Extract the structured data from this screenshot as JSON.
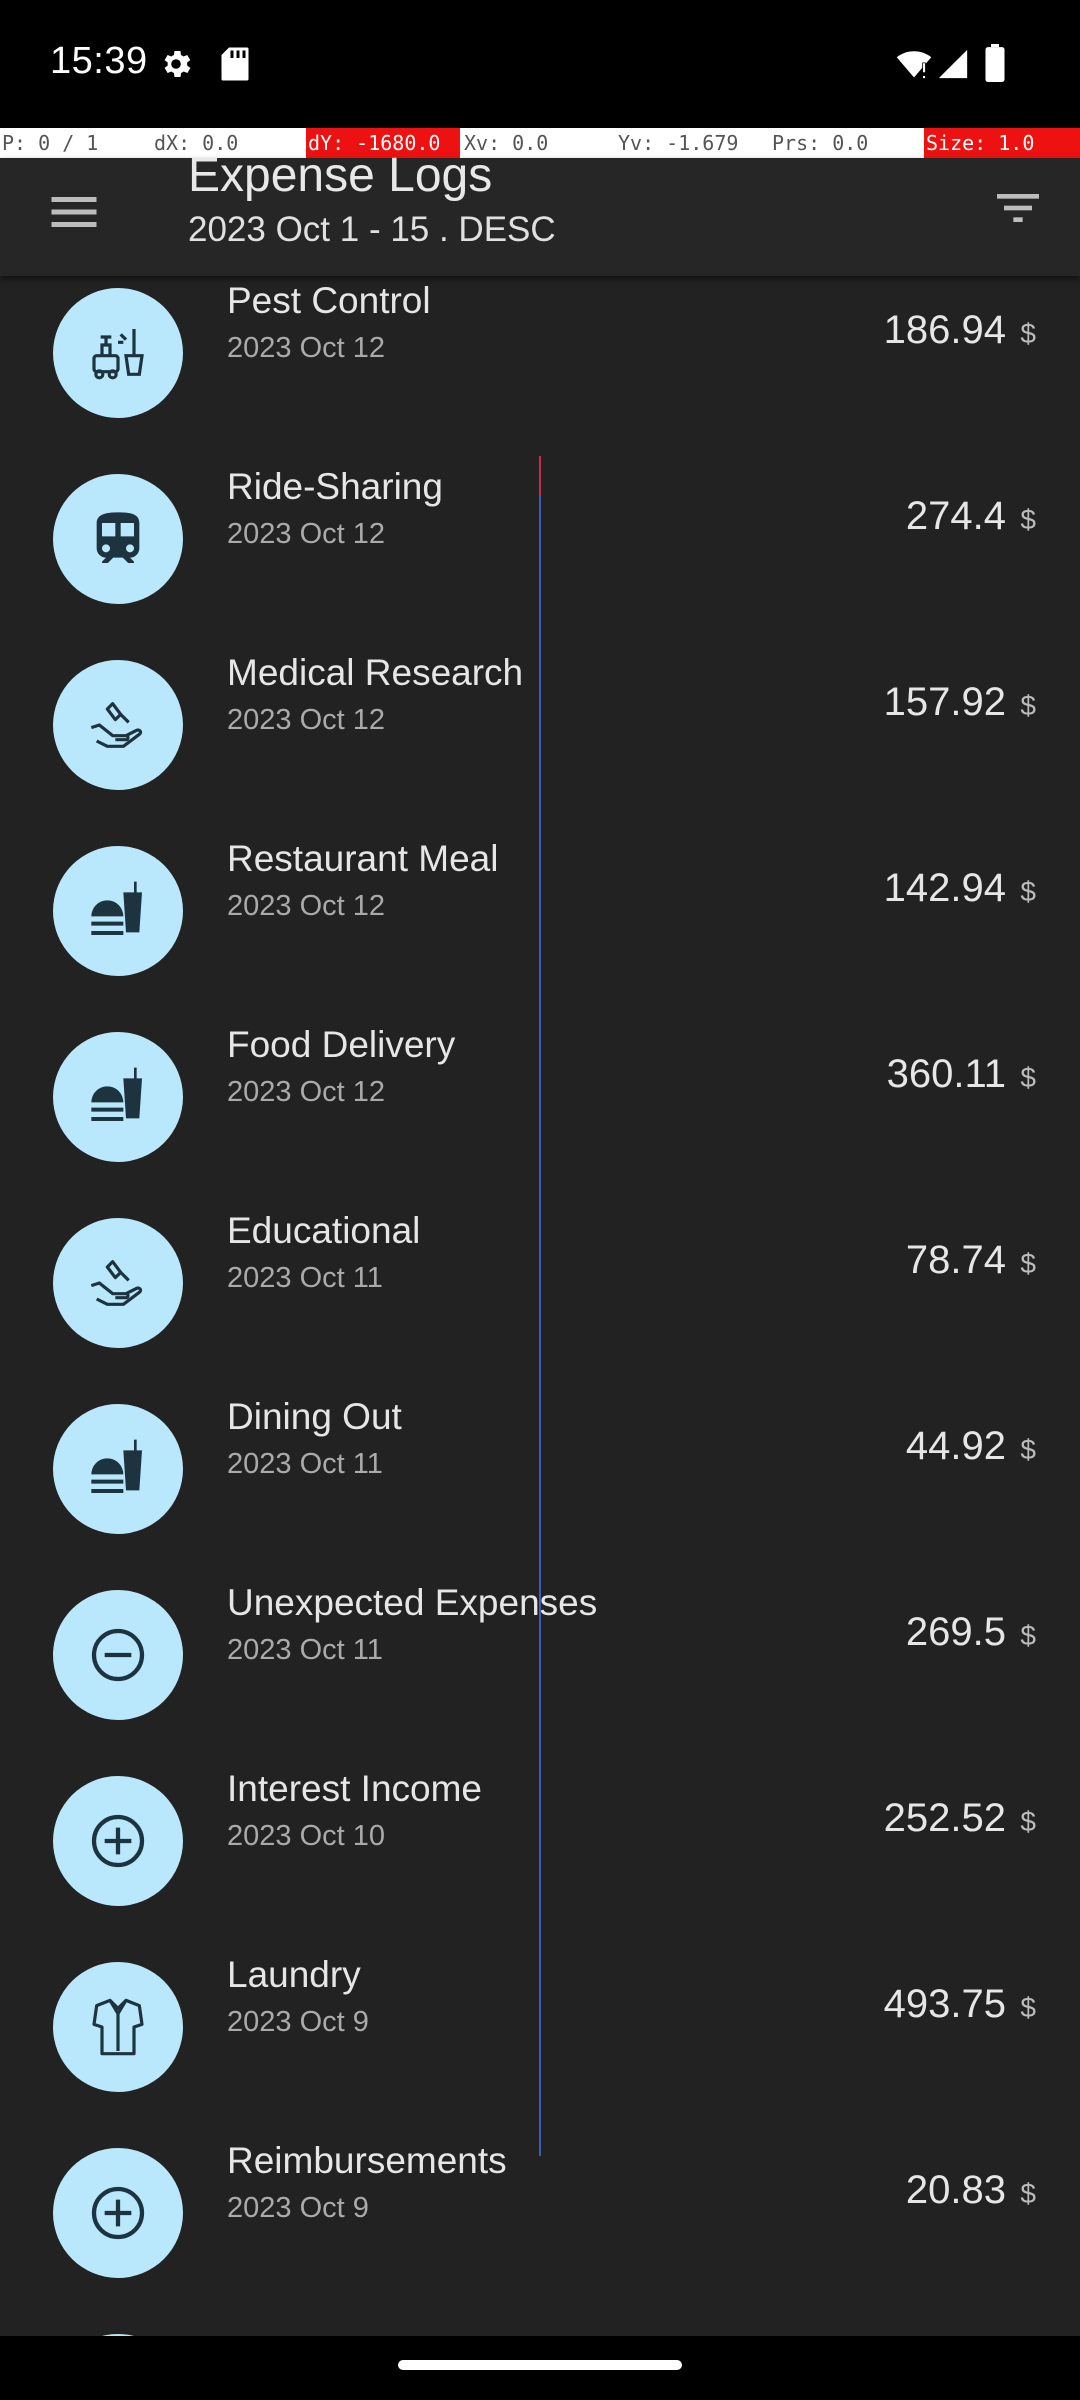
{
  "status_bar": {
    "time": "15:39",
    "icons": [
      "settings-gear-icon",
      "sd-card-icon",
      "wifi-icon",
      "cell-signal-icon",
      "battery-icon"
    ]
  },
  "debug_overlay": {
    "pointer": "P: 0 / 1",
    "dx": "dX: 0.0",
    "dy": "dY: -1680.0",
    "xv": "Xv: 0.0",
    "yv": "Yv: -1.679",
    "prs": "Prs: 0.0",
    "size": "Size: 1.0"
  },
  "header": {
    "title": "Expense Logs",
    "subtitle": "2023 Oct 1 - 15 . DESC",
    "menu_icon": "hamburger-menu-icon",
    "filter_icon": "filter-icon"
  },
  "colors": {
    "background": "#222222",
    "icon_circle": "#b9e7fb",
    "icon_glyph": "#1d3440"
  },
  "expenses": [
    {
      "title": "Pest Control",
      "date": "2023 Oct 12",
      "amount": "186.94",
      "currency": "$",
      "icon": "pest-control-icon"
    },
    {
      "title": "Ride-Sharing",
      "date": "2023 Oct 12",
      "amount": "274.4",
      "currency": "$",
      "icon": "train-icon"
    },
    {
      "title": "Medical Research",
      "date": "2023 Oct 12",
      "amount": "157.92",
      "currency": "$",
      "icon": "hand-coin-icon"
    },
    {
      "title": "Restaurant Meal",
      "date": "2023 Oct 12",
      "amount": "142.94",
      "currency": "$",
      "icon": "fastfood-icon"
    },
    {
      "title": "Food Delivery",
      "date": "2023 Oct 12",
      "amount": "360.11",
      "currency": "$",
      "icon": "fastfood-icon"
    },
    {
      "title": "Educational",
      "date": "2023 Oct 11",
      "amount": "78.74",
      "currency": "$",
      "icon": "hand-coin-icon"
    },
    {
      "title": "Dining Out",
      "date": "2023 Oct 11",
      "amount": "44.92",
      "currency": "$",
      "icon": "fastfood-icon"
    },
    {
      "title": "Unexpected Expenses",
      "date": "2023 Oct 11",
      "amount": "269.5",
      "currency": "$",
      "icon": "minus-circle-icon"
    },
    {
      "title": "Interest Income",
      "date": "2023 Oct 10",
      "amount": "252.52",
      "currency": "$",
      "icon": "plus-circle-icon"
    },
    {
      "title": "Laundry",
      "date": "2023 Oct 9",
      "amount": "493.75",
      "currency": "$",
      "icon": "shirt-icon"
    },
    {
      "title": "Reimbursements",
      "date": "2023 Oct 9",
      "amount": "20.83",
      "currency": "$",
      "icon": "plus-circle-icon"
    },
    {
      "title": "",
      "date": "",
      "amount": "",
      "currency": "",
      "icon": "partial-row-icon"
    }
  ]
}
